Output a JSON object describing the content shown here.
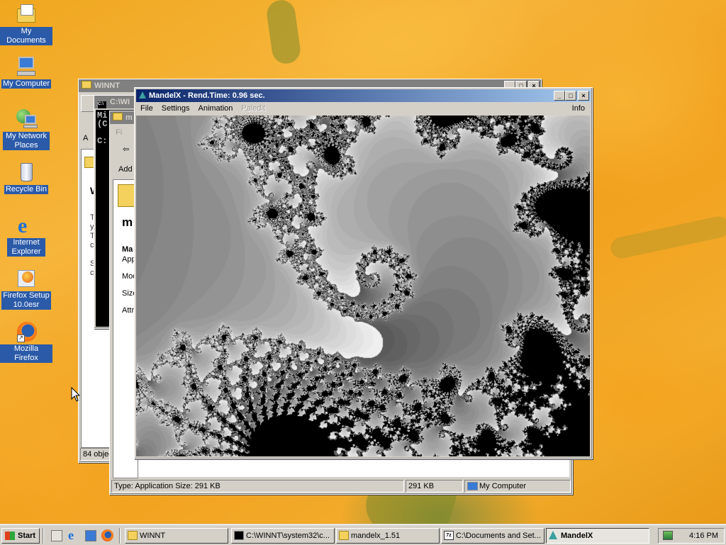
{
  "desktop": {
    "icons": [
      {
        "label": "My Documents",
        "icon": "folder-documents-icon"
      },
      {
        "label": "My Computer",
        "icon": "computer-icon"
      },
      {
        "label": "My Network Places",
        "icon": "network-icon"
      },
      {
        "label": "Recycle Bin",
        "icon": "recycle-bin-icon"
      },
      {
        "label": "Internet Explorer",
        "icon": "internet-explorer-icon"
      },
      {
        "label": "Firefox Setup 10.0esr",
        "icon": "firefox-setup-icon"
      },
      {
        "label": "Mozilla Firefox",
        "icon": "firefox-icon"
      }
    ]
  },
  "winnt_window": {
    "title": "WINNT",
    "status": "84 objec",
    "side_letter": "A"
  },
  "cmd_window": {
    "title": "C:\\WI",
    "lines": [
      "Mi",
      "(C",
      "C:"
    ]
  },
  "folder_window": {
    "title": "m",
    "toolbar_partial": [
      "Fi",
      "Add"
    ],
    "heading": "m",
    "details": [
      "Ma",
      "App",
      "Mod",
      "Size",
      "Attr"
    ],
    "status_main": "Type: Application Size: 291 KB",
    "status_size": "291 KB",
    "status_zone": "My Computer"
  },
  "mandelx_window": {
    "title": "MandelX - Rend.Time:  0.96 sec.",
    "menu": {
      "file": "File",
      "settings": "Settings",
      "animation": "Animation",
      "palette": "Paledit",
      "info": "Info"
    }
  },
  "taskbar": {
    "start": "Start",
    "buttons": [
      {
        "label": "WINNT"
      },
      {
        "label": "C:\\WINNT\\system32\\c..."
      },
      {
        "label": "mandelx_1.51"
      },
      {
        "label": "C:\\Documents and Set..."
      },
      {
        "label": "MandelX"
      }
    ],
    "clock": "4:16 PM"
  },
  "colors": {
    "active_title_start": "#0a246a",
    "active_title_end": "#a6caf0",
    "face": "#d4d0c8",
    "desktop_orange": "#f3ac2c"
  }
}
